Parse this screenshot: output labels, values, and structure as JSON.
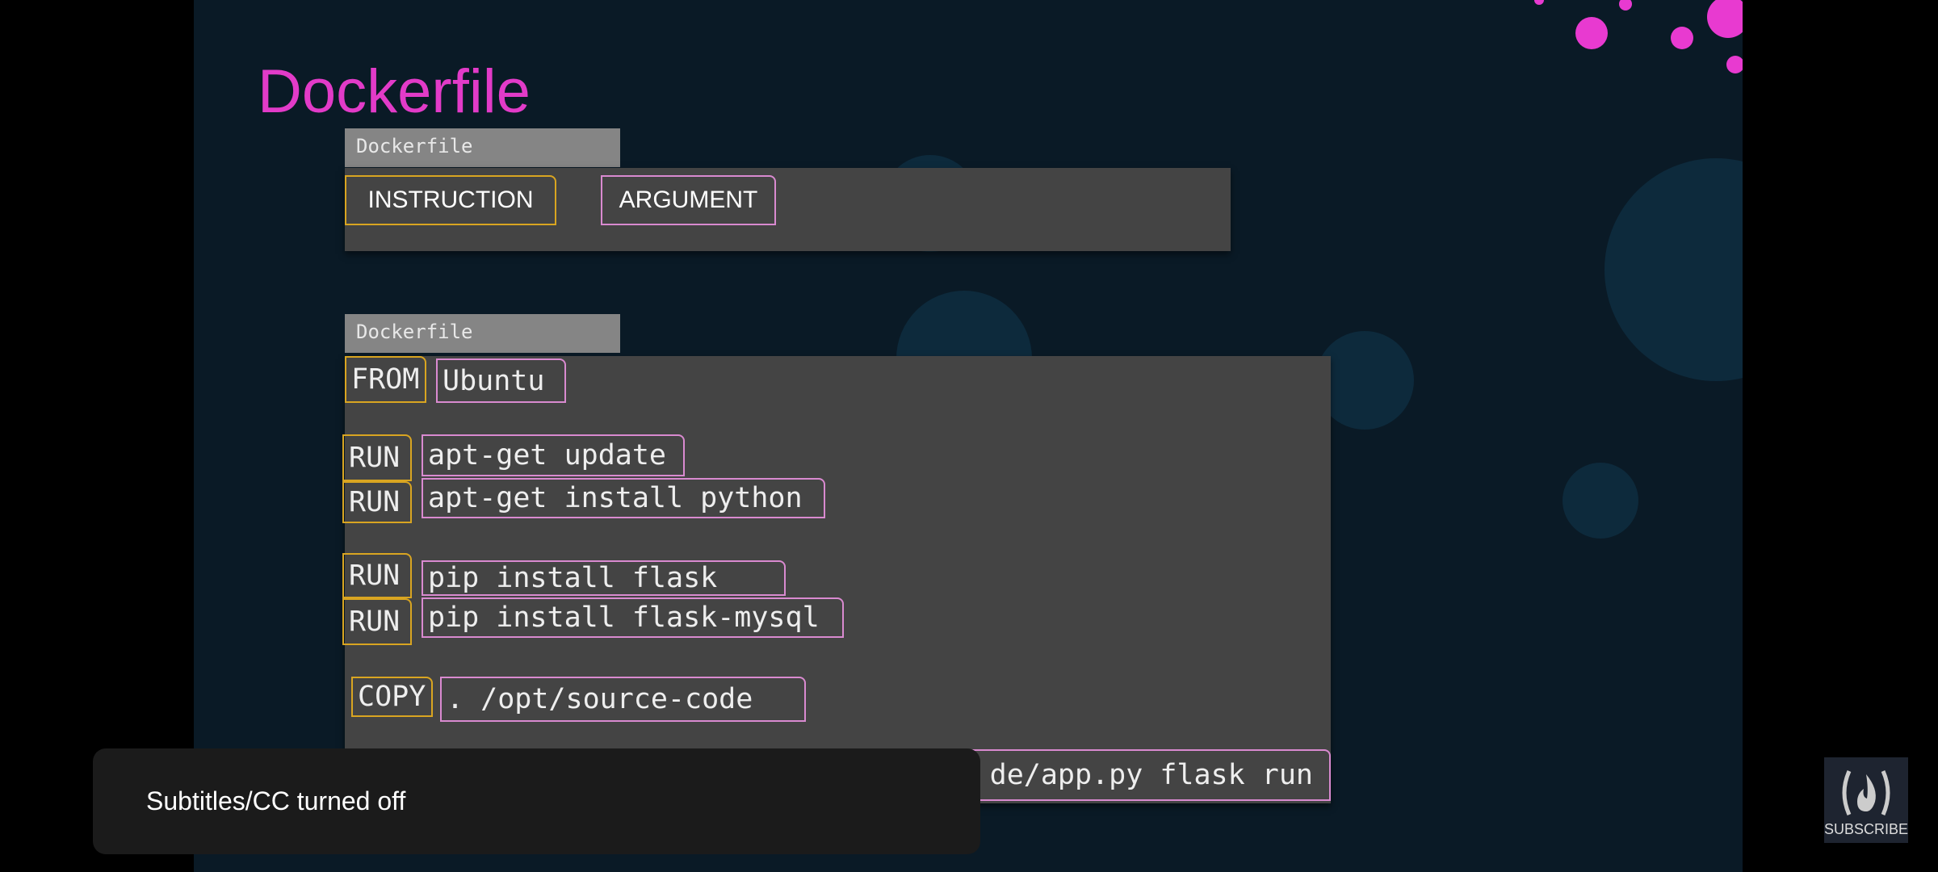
{
  "slide": {
    "title": "Dockerfile"
  },
  "syntax": {
    "tab": "Dockerfile",
    "instruction": "INSTRUCTION",
    "argument": "ARGUMENT"
  },
  "example": {
    "tab": "Dockerfile",
    "rows": [
      {
        "instruction": "FROM",
        "argument": "Ubuntu"
      },
      {
        "instruction": "RUN",
        "argument": "apt-get update"
      },
      {
        "instruction": "RUN",
        "argument": "apt-get install python"
      },
      {
        "instruction": "RUN",
        "argument": "pip install flask"
      },
      {
        "instruction": "RUN",
        "argument": "pip install flask-mysql"
      },
      {
        "instruction": "COPY",
        "argument": ". /opt/source-code"
      },
      {
        "argument": "de/app.py flask run"
      }
    ]
  },
  "toast": {
    "text": "Subtitles/CC turned off"
  },
  "subscribe": {
    "label": "SUBSCRIBE"
  },
  "colors": {
    "title": "#e23bc8",
    "instruction_border": "#d9a521",
    "argument_border": "#d98ad0"
  }
}
